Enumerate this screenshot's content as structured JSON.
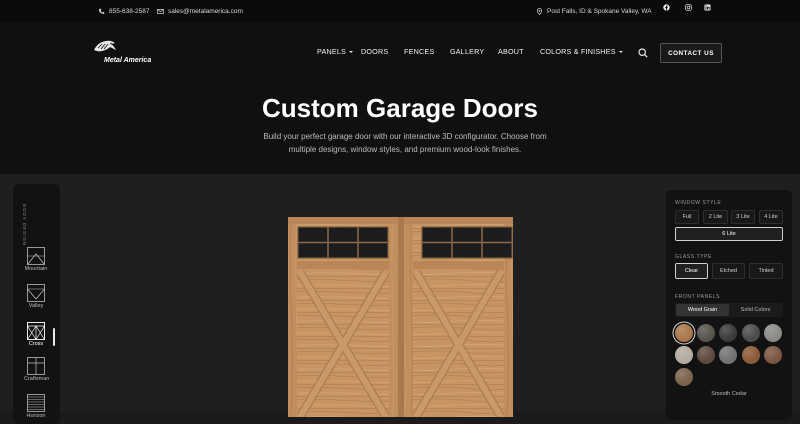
{
  "topbar": {
    "phone": "855-638-2587",
    "email": "sales@metalamerica.com",
    "location": "Post Falls, ID & Spokane Valley, WA",
    "social": [
      "facebook-icon",
      "instagram-icon",
      "linkedin-icon"
    ]
  },
  "logo": {
    "text": "Metal America"
  },
  "nav": {
    "items": [
      "PANELS",
      "DOORS",
      "FENCES",
      "GALLERY",
      "ABOUT",
      "COLORS & FINISHES"
    ],
    "contact_label": "CONTACT US"
  },
  "hero": {
    "title": "Custom Garage Doors",
    "subtitle": "Build your perfect garage door with our interactive 3D configurator. Choose from multiple designs, window styles, and premium wood-look finishes."
  },
  "body_design": {
    "label": "BODY DESIGN",
    "designs": [
      "Mountain",
      "Valley",
      "Cross",
      "Craftsman",
      "Horizon"
    ],
    "selected": "Cross"
  },
  "config": {
    "window_style": {
      "title": "WINDOW STYLE",
      "options": [
        "Full",
        "2 Lite",
        "3 Lite",
        "4 Lite",
        "6 Lite"
      ],
      "selected": "6 Lite"
    },
    "glass_type": {
      "title": "GLASS TYPE",
      "options": [
        "Clear",
        "Etched",
        "Tinted"
      ],
      "selected": "Clear"
    },
    "front_panels": {
      "title": "FRONT PANELS",
      "tabs": [
        "Wood Grain",
        "Solid Colors"
      ],
      "active_tab": "Wood Grain",
      "swatch_colors": [
        "#a9774a",
        "#57524c",
        "#3a3a3a",
        "#4b4b4b",
        "#8a8a86",
        "#b4aba0",
        "#5e4a3e",
        "#727272",
        "#8a5a36",
        "#7b5540",
        "#7a624b"
      ],
      "selected_name": "Smooth Cedar"
    }
  }
}
